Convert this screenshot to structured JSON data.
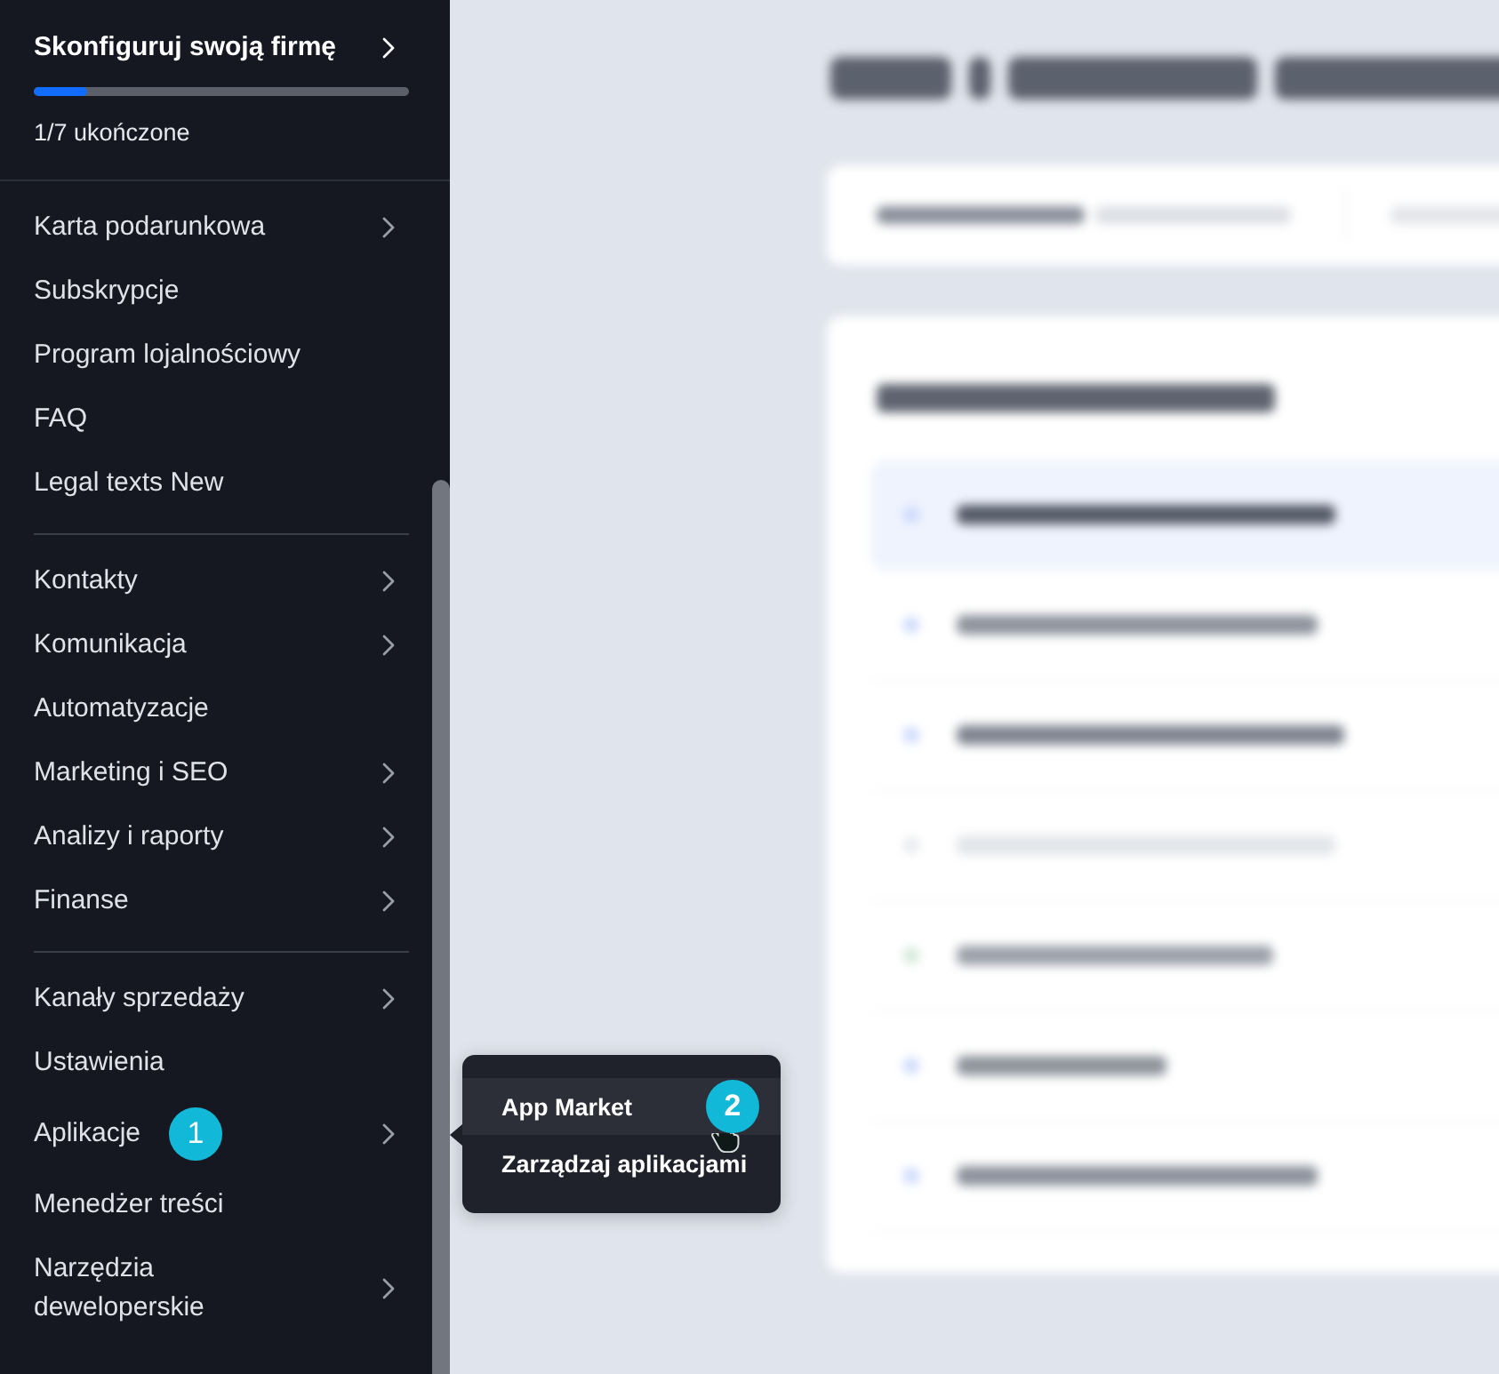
{
  "setup": {
    "title": "Skonfiguruj swoją firmę",
    "level": 0.14,
    "status": "1/7 ukończone"
  },
  "menu_groups": [
    {
      "items": [
        {
          "label": "Karta podarunkowa",
          "has_submenu": true
        },
        {
          "label": "Subskrypcje",
          "has_submenu": false
        },
        {
          "label": "Program lojalnościowy",
          "has_submenu": false
        },
        {
          "label": "FAQ",
          "has_submenu": false
        },
        {
          "label": "Legal texts New",
          "has_submenu": false
        }
      ]
    },
    {
      "items": [
        {
          "label": "Kontakty",
          "has_submenu": true
        },
        {
          "label": "Komunikacja",
          "has_submenu": true
        },
        {
          "label": "Automatyzacje",
          "has_submenu": false
        },
        {
          "label": "Marketing i SEO",
          "has_submenu": true
        },
        {
          "label": "Analizy i raporty",
          "has_submenu": true
        },
        {
          "label": "Finanse",
          "has_submenu": true
        }
      ]
    },
    {
      "items": [
        {
          "label": "Kanały sprzedaży",
          "has_submenu": true
        },
        {
          "label": "Ustawienia",
          "has_submenu": false
        },
        {
          "label": "Aplikacje",
          "has_submenu": true,
          "badge": "1",
          "submenu": {
            "items": [
              {
                "label": "App Market",
                "selected": true,
                "badge": "2"
              },
              {
                "label": "Zarządzaj aplikacjami",
                "selected": false
              }
            ]
          }
        },
        {
          "label": "Menedżer treści",
          "has_submenu": false
        },
        {
          "label": "Narzędzia deweloperskie",
          "has_submenu": true
        }
      ]
    }
  ]
}
